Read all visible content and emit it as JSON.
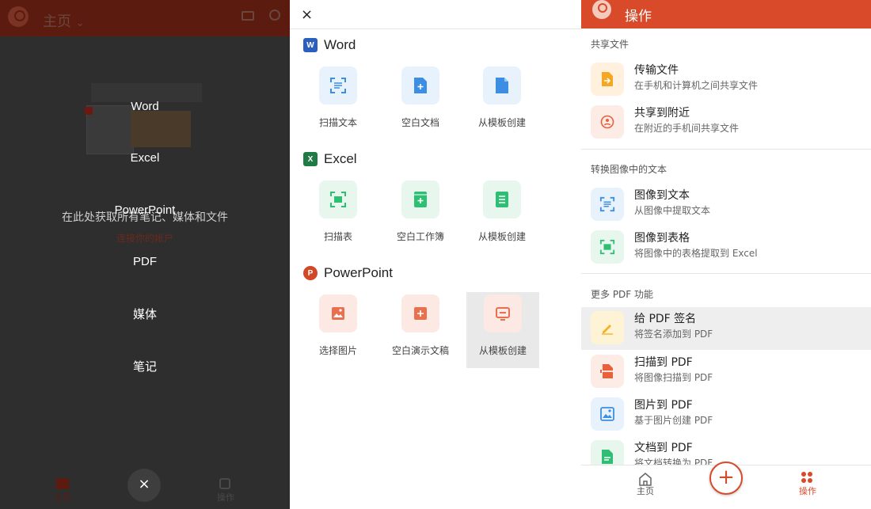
{
  "left_panel": {
    "home_title": "主页",
    "home_caret": "⌄",
    "promo_text": "在此处获取所有笔记、媒体和文件",
    "link_text": "连接你的帐户",
    "create_menu": [
      "Word",
      "Excel",
      "PowerPoint",
      "PDF",
      "媒体",
      "笔记"
    ],
    "bottom_home_label": "主页",
    "bottom_ops_label": "操作",
    "close_symbol": "×"
  },
  "create_panel": {
    "close_symbol": "×",
    "sections": [
      {
        "title": "Word",
        "logo_letter": "W",
        "logo_color": "#2b5fbd",
        "tile_bg": "#e8f2fc",
        "icon_color": "#3b8ee2",
        "options": [
          "扫描文本",
          "空白文档",
          "从模板创建"
        ]
      },
      {
        "title": "Excel",
        "logo_letter": "X",
        "logo_color": "#1f7a45",
        "tile_bg": "#e7f7ee",
        "icon_color": "#2fbf74",
        "options": [
          "扫描表",
          "空白工作簿",
          "从模板创建"
        ]
      },
      {
        "title": "PowerPoint",
        "logo_letter": "P",
        "logo_color": "#d24726",
        "tile_bg": "#fde9e4",
        "icon_color": "#e8704f",
        "options": [
          "选择图片",
          "空白演示文稿",
          "从模板创建"
        ]
      }
    ]
  },
  "actions_panel": {
    "header_title": "操作",
    "groups": [
      {
        "title": "共享文件",
        "items": [
          {
            "title": "传输文件",
            "subtitle": "在手机和计算机之间共享文件",
            "icon": "transfer-file-icon",
            "bg": "#fff1dd",
            "fg": "#f5a623"
          },
          {
            "title": "共享到附近",
            "subtitle": "在附近的手机间共享文件",
            "icon": "share-nearby-icon",
            "bg": "#fdebe6",
            "fg": "#e8603c"
          }
        ]
      },
      {
        "title": "转换图像中的文本",
        "items": [
          {
            "title": "图像到文本",
            "subtitle": "从图像中提取文本",
            "icon": "image-to-text-icon",
            "bg": "#e8f2fc",
            "fg": "#3b8ee2"
          },
          {
            "title": "图像到表格",
            "subtitle": "将图像中的表格提取到 Excel",
            "icon": "image-to-table-icon",
            "bg": "#e7f7ee",
            "fg": "#2fbf74"
          }
        ]
      },
      {
        "title": "更多 PDF 功能",
        "items": [
          {
            "title": "给 PDF 签名",
            "subtitle": "将签名添加到 PDF",
            "icon": "sign-pdf-icon",
            "bg": "#fff3d6",
            "fg": "#f5b223"
          },
          {
            "title": "扫描到 PDF",
            "subtitle": "将图像扫描到 PDF",
            "icon": "scan-to-pdf-icon",
            "bg": "#fdebe6",
            "fg": "#e8603c"
          },
          {
            "title": "图片到 PDF",
            "subtitle": "基于图片创建 PDF",
            "icon": "picture-to-pdf-icon",
            "bg": "#e8f2fc",
            "fg": "#3b8ee2"
          },
          {
            "title": "文档到 PDF",
            "subtitle": "将文档转换为 PDF",
            "icon": "doc-to-pdf-icon",
            "bg": "#e7f7ee",
            "fg": "#2fbf74"
          }
        ]
      }
    ],
    "bottom_nav": {
      "home_label": "主页",
      "fab_symbol": "+",
      "ops_label": "操作"
    }
  },
  "colors": {
    "accent": "#d84a2a",
    "overlay": "#2e2e2e"
  }
}
